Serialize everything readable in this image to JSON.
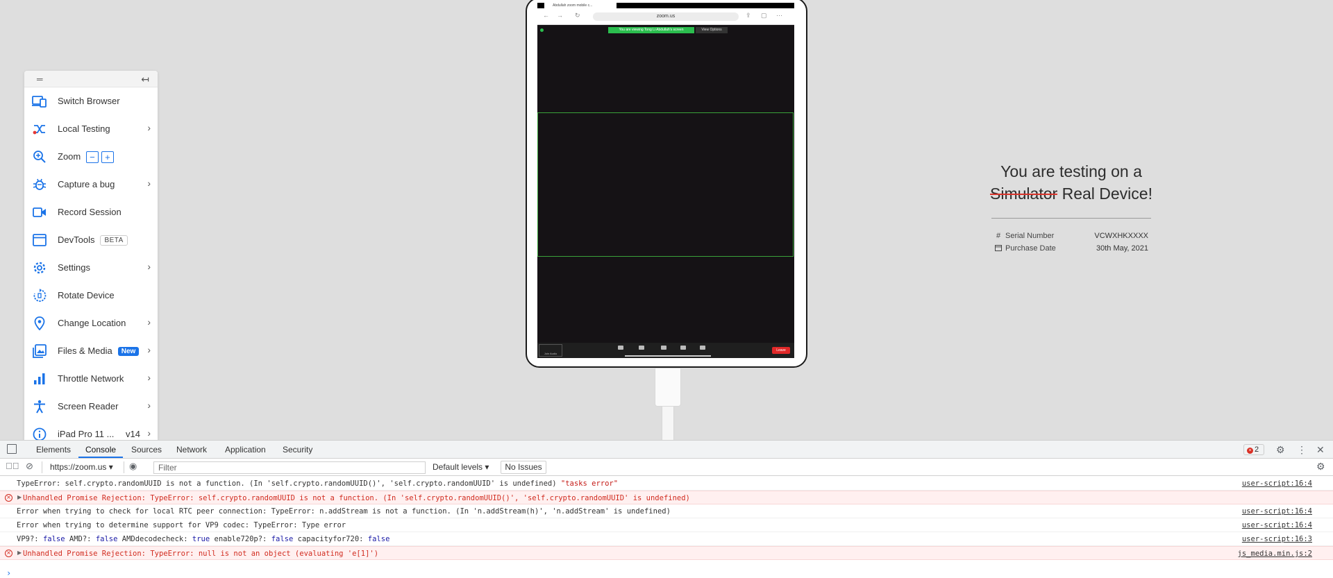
{
  "sidebar": {
    "items": [
      {
        "label": "Switch Browser"
      },
      {
        "label": "Local Testing"
      },
      {
        "label": "Zoom"
      },
      {
        "label": "Capture a bug"
      },
      {
        "label": "Record Session"
      },
      {
        "label": "DevTools",
        "badge": "BETA"
      },
      {
        "label": "Settings"
      },
      {
        "label": "Rotate Device"
      },
      {
        "label": "Change Location"
      },
      {
        "label": "Files & Media",
        "badge": "New"
      },
      {
        "label": "Throttle Network"
      },
      {
        "label": "Screen Reader"
      },
      {
        "label": "iPad Pro 11 ...",
        "version": "v14"
      }
    ],
    "zoom_minus": "−",
    "zoom_plus": "+"
  },
  "device": {
    "tab_title": "Abdullah zoom mobile c...",
    "url": "zoom.us",
    "banner": "You are viewing Tong Li Abdullah's screen",
    "view_options": "View Options",
    "join_audio": "Join Audio",
    "leave": "Leave"
  },
  "info": {
    "title_line1": "You are testing on a",
    "title_strike": "Simulator",
    "title_rest": " Real Device!",
    "rows": [
      {
        "icon": "#",
        "key": "Serial Number",
        "value": "VCWXHKXXXX"
      },
      {
        "icon": "calendar",
        "key": "Purchase Date",
        "value": "30th May, 2021"
      }
    ]
  },
  "devtools": {
    "tabs": [
      "Elements",
      "Console",
      "Sources",
      "Network",
      "Application",
      "Security"
    ],
    "active_tab": "Console",
    "error_count": "2",
    "context": "https://zoom.us",
    "filter_placeholder": "Filter",
    "levels": "Default levels",
    "issues": "No Issues",
    "logs": [
      {
        "type": "info",
        "text": "TypeError: self.crypto.randomUUID is not a function. (In 'self.crypto.randomUUID()', 'self.crypto.randomUUID' is undefined) ",
        "text_str": "\"tasks error\"",
        "source": "user-script:16:4"
      },
      {
        "type": "error",
        "text": "Unhandled Promise Rejection: TypeError: self.crypto.randomUUID is not a function. (In 'self.crypto.randomUUID()', 'self.crypto.randomUUID' is undefined)",
        "source": ""
      },
      {
        "type": "info",
        "text": "Error when trying to check for local RTC peer connection: TypeError: n.addStream is not a function. (In 'n.addStream(h)', 'n.addStream' is undefined)",
        "source": "user-script:16:4"
      },
      {
        "type": "info",
        "text": "Error when trying to determine support for VP9 codec: TypeError: Type error",
        "source": "user-script:16:4"
      },
      {
        "type": "info",
        "text": "VP9?: ",
        "kw1": "false",
        "t2": " AMD?: ",
        "kw2": "false",
        "t3": " AMDdecodecheck: ",
        "kw3": "true",
        "t4": " enable720p?: ",
        "kw4": "false",
        "t5": " capacityfor720: ",
        "kw5": "false",
        "source": "user-script:16:3"
      },
      {
        "type": "error",
        "text": "Unhandled Promise Rejection: TypeError: null is not an object (evaluating 'e[1]')",
        "source": "js_media.min.js:2"
      }
    ],
    "prompt": "›"
  },
  "colors": {
    "accent": "#1a73e8",
    "error": "#d12b1f",
    "stage_bg": "#dedede"
  }
}
